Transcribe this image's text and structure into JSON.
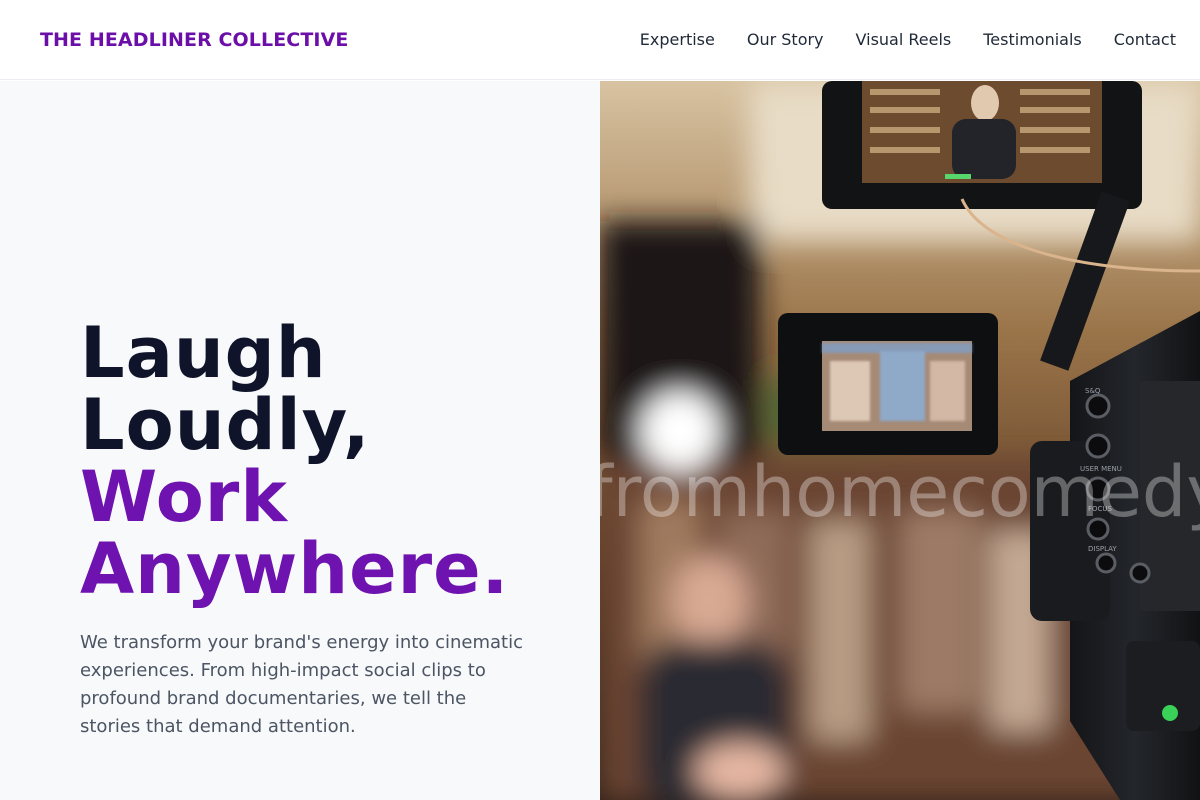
{
  "header": {
    "brand": "THE HEADLINER COLLECTIVE",
    "nav": [
      "Expertise",
      "Our Story",
      "Visual Reels",
      "Testimonials",
      "Contact"
    ]
  },
  "hero": {
    "headline_line1": "Laugh",
    "headline_line2": "Loudly,",
    "headline_line3": "Work",
    "headline_line4": "Anywhere.",
    "description": "We transform your brand's energy into cinematic experiences. From high-impact social clips to profound brand documentaries, we tell the stories that demand attention.",
    "image_watermark": "fromhomecomedy"
  },
  "colors": {
    "brand_purple": "#6b0fa8",
    "headline_dark": "#10142a",
    "headline_accent": "#6e12b0",
    "body_text": "#4b5563",
    "left_panel_bg": "#f8f9fb"
  },
  "icons": {
    "hero_image": "video-camera-production-photo"
  }
}
